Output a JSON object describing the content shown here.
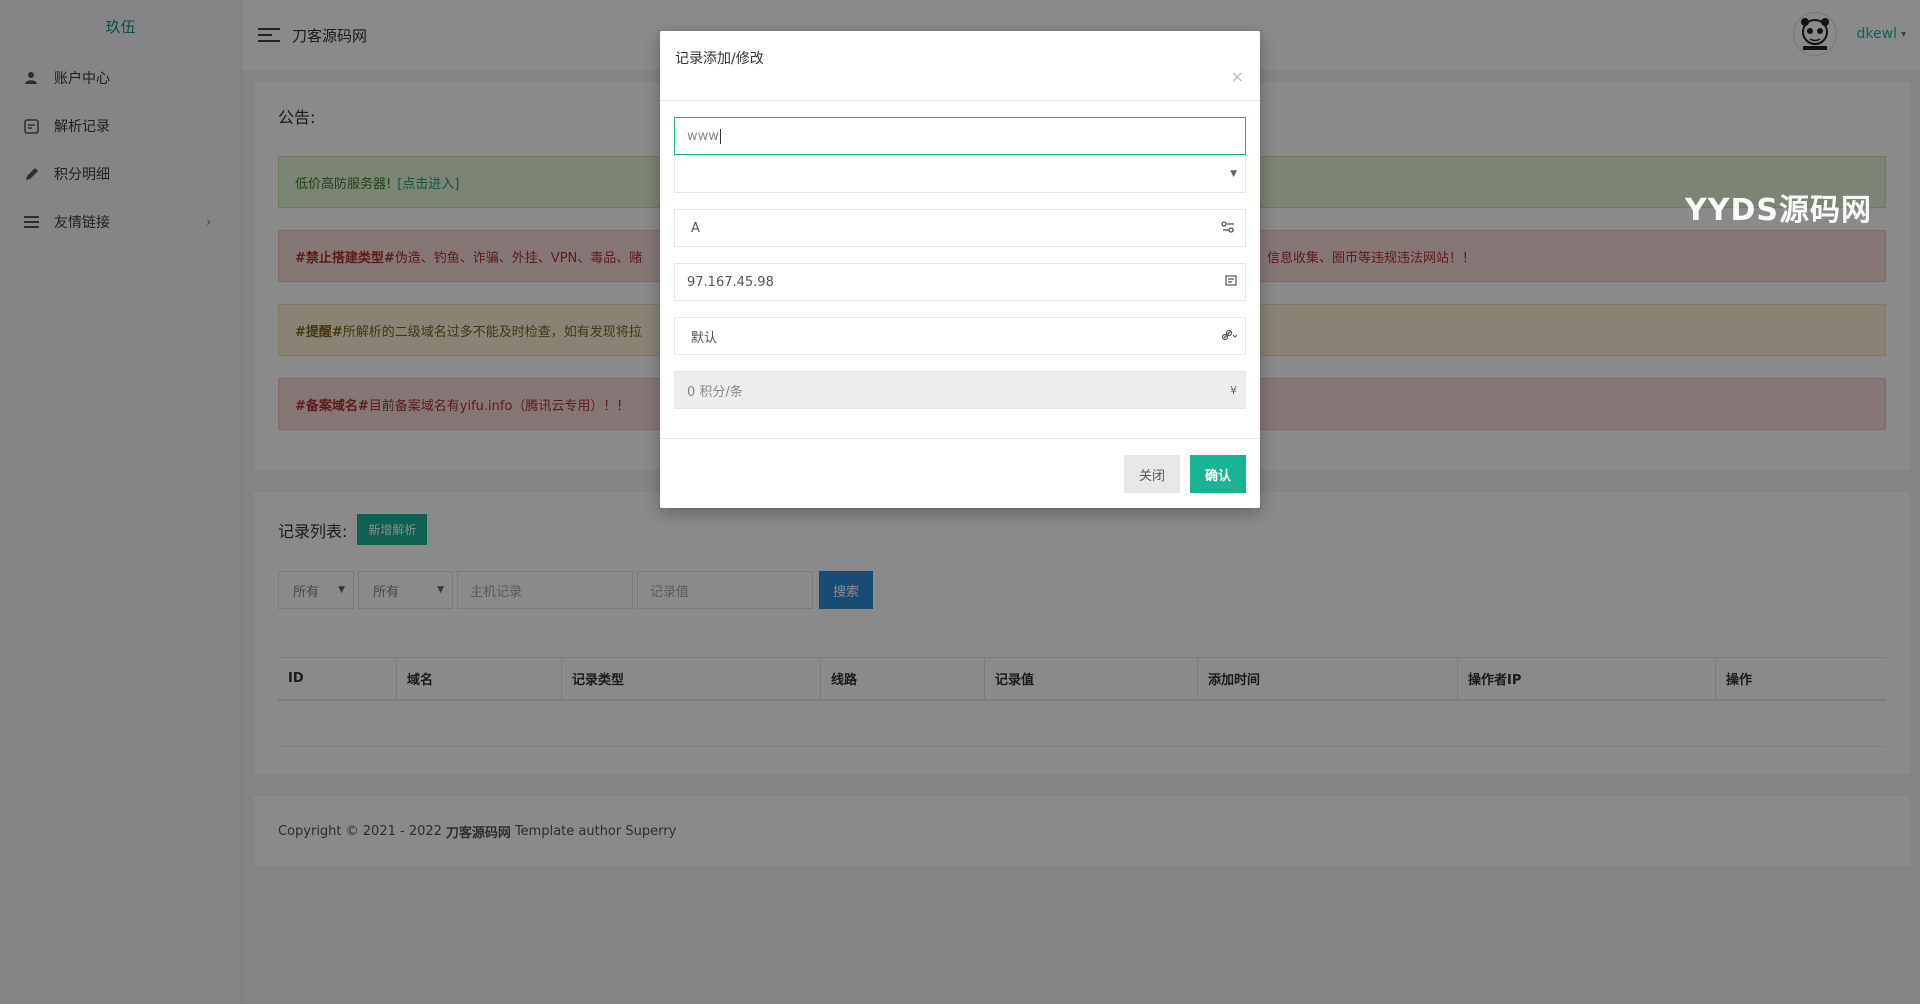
{
  "sidebar": {
    "logo_alt": "玖伍",
    "items": [
      {
        "label": "账户中心",
        "icon": "user-icon"
      },
      {
        "label": "解析记录",
        "icon": "record-icon"
      },
      {
        "label": "积分明细",
        "icon": "pencil-icon"
      },
      {
        "label": "友情链接",
        "icon": "menu-icon",
        "arrow": "›"
      }
    ]
  },
  "header": {
    "title": "刀客源码网",
    "username": "dkewl",
    "caret": "▾"
  },
  "announcement": {
    "title": "公告:",
    "notices": [
      {
        "text": "低价高防服务器!",
        "link": "[点击进入]"
      },
      {
        "bold": "#禁止搭建类型#",
        "text": " 伪造、钓鱼、诈骗、外挂、VPN、毒品、赌",
        "tail": "信息收集、圈币等违规违法网站！！"
      },
      {
        "bold": "#提醒#",
        "text": " 所解析的二级域名过多不能及时检查，如有发现将拉"
      },
      {
        "bold": "#备案域名#",
        "text": " 目前备案域名有yifu.info（腾讯云专用）！！"
      }
    ]
  },
  "records": {
    "title": "记录列表:",
    "add_button": "新增解析",
    "filter_all_1": "所有",
    "filter_all_2": "所有",
    "host_placeholder": "主机记录",
    "value_placeholder": "记录值",
    "search_button": "搜索",
    "columns": [
      "ID",
      "域名",
      "记录类型",
      "线路",
      "记录值",
      "添加时间",
      "操作者IP",
      "操作"
    ]
  },
  "footer": {
    "prefix": "Copyright © 2021 - 2022 ",
    "brand": "刀客源码网",
    "suffix": " Template author Superry"
  },
  "watermark": "YYDS源码网",
  "modal": {
    "title": "记录添加/修改",
    "close_x": "×",
    "host_value": "www",
    "domain_select": "",
    "type_value": "A",
    "record_value": "97.167.45.98",
    "line_value": "默认",
    "cost_value": "0 积分/条",
    "cost_icon_text": "¥",
    "close_button": "关闭",
    "confirm_button": "确认"
  }
}
